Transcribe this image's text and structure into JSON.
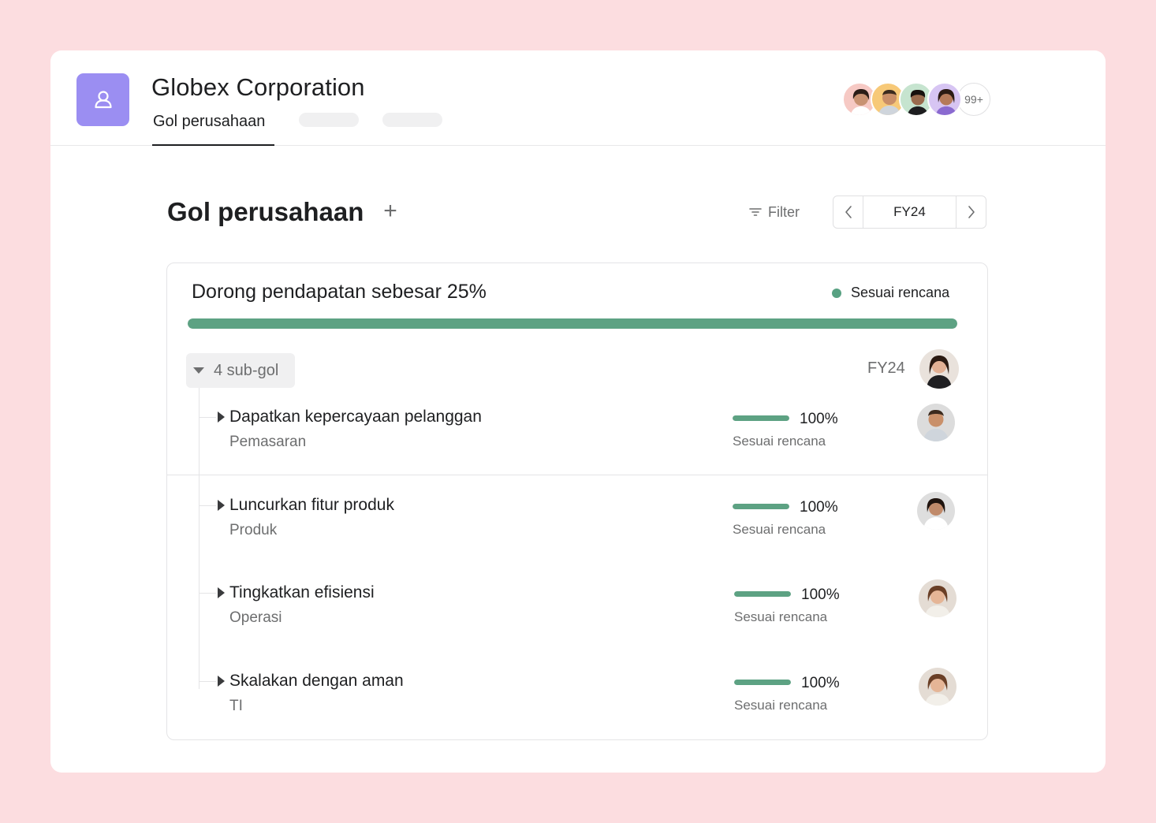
{
  "header": {
    "org_name": "Globex Corporation",
    "tabs": [
      {
        "label": "Gol perusahaan",
        "active": true
      }
    ],
    "members": {
      "overflow_count": "99+"
    }
  },
  "toolbar": {
    "title": "Gol perusahaan",
    "add_icon": "plus-icon",
    "filter_label": "Filter",
    "period": "FY24"
  },
  "goal": {
    "title": "Dorong pendapatan sebesar 25%",
    "status": "Sesuai rencana",
    "status_color": "#58a182",
    "progress": 1.0,
    "period": "FY24",
    "subgoals_label": "4 sub-gol",
    "subgoals": [
      {
        "name": "Dapatkan kepercayaan pelanggan",
        "team": "Pemasaran",
        "percent": "100%",
        "progress": 1.0,
        "status": "Sesuai rencana"
      },
      {
        "name": "Luncurkan fitur produk",
        "team": "Produk",
        "percent": "100%",
        "progress": 1.0,
        "status": "Sesuai rencana"
      },
      {
        "name": "Tingkatkan efisiensi",
        "team": "Operasi",
        "percent": "100%",
        "progress": 1.0,
        "status": "Sesuai rencana"
      },
      {
        "name": "Skalakan dengan aman",
        "team": "TI",
        "percent": "100%",
        "progress": 1.0,
        "status": "Sesuai rencana"
      }
    ]
  },
  "colors": {
    "accent": "#9b8ef2",
    "progress": "#5da283",
    "background": "#fcdde0"
  }
}
